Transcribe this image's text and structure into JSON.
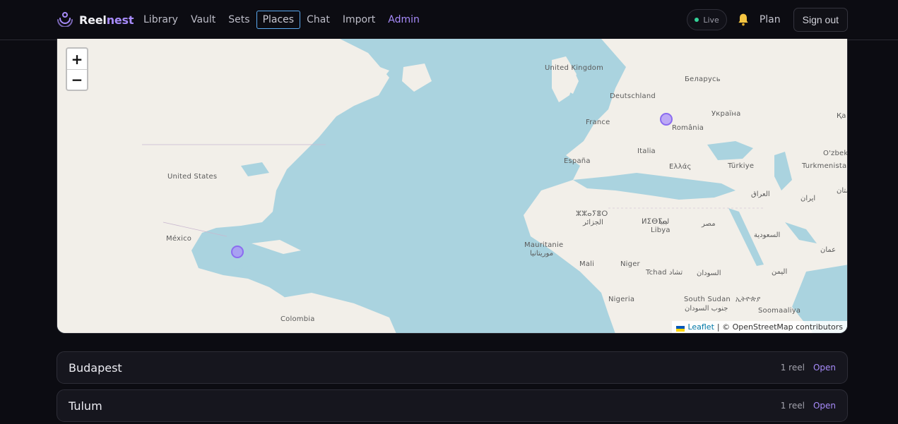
{
  "brand": {
    "name_part1": "Reel",
    "name_part2": "nest",
    "icon": "signal-logo-icon"
  },
  "nav": {
    "links": [
      {
        "label": "Library"
      },
      {
        "label": "Vault"
      },
      {
        "label": "Sets"
      },
      {
        "label": "Places",
        "active": true
      },
      {
        "label": "Chat"
      },
      {
        "label": "Import"
      },
      {
        "label": "Admin"
      }
    ]
  },
  "header_right": {
    "live_label": "Live",
    "bell_icon": "bell-icon",
    "plan_label": "Plan",
    "signout_label": "Sign out"
  },
  "map": {
    "zoom_in": "+",
    "zoom_out": "−",
    "labels": {
      "united_kingdom": "United Kingdom",
      "belarus": "Беларусь",
      "deutschland": "Deutschland",
      "ukraina": "Україна",
      "france": "France",
      "romania": "România",
      "kaz": "Қа",
      "ozbek": "O'zbek",
      "espana": "España",
      "italia": "Italia",
      "turkiye": "Türkiye",
      "turkmenistan": "Turkmenista",
      "ellas": "Ελλάς",
      "united_states": "United States",
      "iraq": "العراق",
      "iran": "ایران",
      "iran_edge": "ستان",
      "algeria_tif": "ⵣⵣⴰⵢⴻⵔ",
      "algeria_ar": "الجزائر",
      "libya_tif": "ⵍⵉⴱⵢⴰ",
      "libya_ar": "ليبيا",
      "libya": "Libya",
      "misr": "مصر",
      "saudi": "السعودية",
      "mexico": "México",
      "mauritanie": "Mauritanie",
      "mauritania_ar": "موريتانيا",
      "oman": "عمان",
      "mali": "Mali",
      "niger": "Niger",
      "tchad": "Tchad",
      "tchad_ar": "تشاد",
      "sudan": "السودان",
      "yemen": "اليمن",
      "nigeria": "Nigeria",
      "south_sudan": "South Sudan",
      "south_sudan_ar": "جنوب السودان",
      "ethiopia": "ኢትዮጵያ",
      "somalia": "Soomaaliya",
      "colombia": "Colombia"
    },
    "attribution_leaflet": "Leaflet",
    "attribution_rest": "| © OpenStreetMap contributors"
  },
  "places": [
    {
      "name": "Budapest",
      "count": "1 reel",
      "action": "Open"
    },
    {
      "name": "Tulum",
      "count": "1 reel",
      "action": "Open"
    }
  ],
  "colors": {
    "accent": "#a78bfa",
    "live": "#34d399",
    "water": "#aad3df",
    "land": "#f2efe9"
  }
}
